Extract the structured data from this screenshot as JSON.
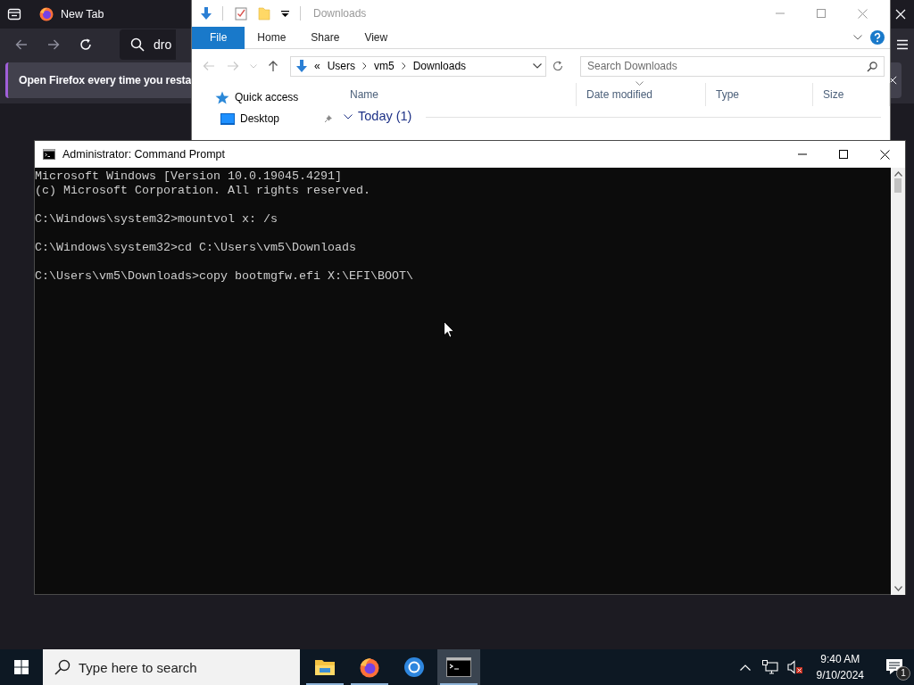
{
  "firefox": {
    "tabs": [
      {
        "label": "New Tab",
        "selected": true
      }
    ],
    "address_text": "dro",
    "notice": "Open Firefox every time you resta"
  },
  "explorer": {
    "title": "Downloads",
    "ribbon_tabs": [
      {
        "label": "File",
        "selected": true
      },
      {
        "label": "Home",
        "selected": false
      },
      {
        "label": "Share",
        "selected": false
      },
      {
        "label": "View",
        "selected": false
      }
    ],
    "address": {
      "overflow": "«",
      "parts": [
        "Users",
        "vm5",
        "Downloads"
      ]
    },
    "search": {
      "placeholder": "Search Downloads"
    },
    "nav": [
      {
        "label": "Quick access",
        "kind": "quick-access",
        "pinned": false
      },
      {
        "label": "Desktop",
        "kind": "desktop",
        "pinned": true
      }
    ],
    "columns": [
      {
        "label": "Name",
        "sorted": false
      },
      {
        "label": "Date modified",
        "sorted": true
      },
      {
        "label": "Type",
        "sorted": false
      },
      {
        "label": "Size",
        "sorted": false
      }
    ],
    "groups": [
      {
        "label": "Today (1)",
        "expanded": true
      }
    ]
  },
  "cmd": {
    "title": "Administrator: Command Prompt",
    "paragraphs": [
      [
        "Microsoft Windows [Version 10.0.19045.4291]",
        "(c) Microsoft Corporation. All rights reserved."
      ],
      [
        "C:\\Windows\\system32>mountvol x: /s"
      ],
      [
        "C:\\Windows\\system32>cd C:\\Users\\vm5\\Downloads"
      ],
      [
        "C:\\Users\\vm5\\Downloads>copy bootmgfw.efi X:\\EFI\\BOOT\\"
      ]
    ]
  },
  "taskbar": {
    "search": {
      "placeholder": "Type here to search"
    },
    "apps": [
      {
        "kind": "explorer",
        "running": true,
        "selected": false
      },
      {
        "kind": "firefox",
        "running": true,
        "selected": false
      },
      {
        "kind": "browser",
        "running": false,
        "selected": false
      },
      {
        "kind": "terminal",
        "running": true,
        "selected": true
      }
    ],
    "time": "9:40 AM",
    "date": "9/10/2024",
    "notification_count": "1",
    "muted": true
  }
}
